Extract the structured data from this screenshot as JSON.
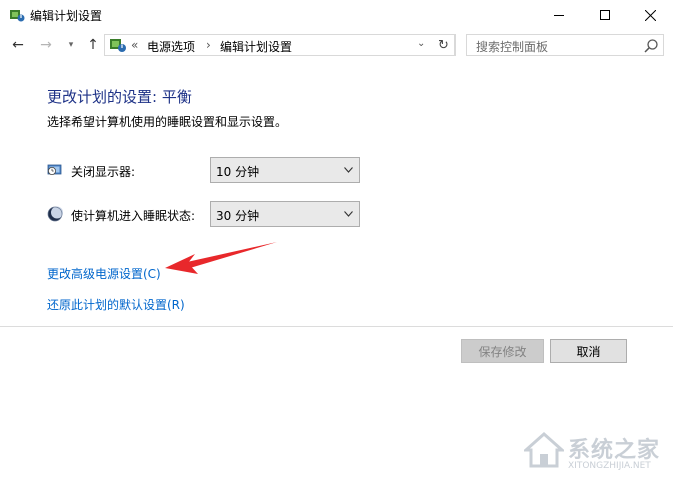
{
  "window": {
    "title": "编辑计划设置"
  },
  "nav": {
    "back_icon": "←",
    "forward_icon": "→",
    "recent_icon": "▾",
    "up_icon": "↑"
  },
  "address": {
    "more": "«",
    "part1": "电源选项",
    "separator": "›",
    "part2": "编辑计划设置",
    "dropdown": "⌄",
    "refresh": "↻"
  },
  "search": {
    "placeholder": "搜索控制面板"
  },
  "main": {
    "heading": "更改计划的设置: 平衡",
    "subtext": "选择希望计算机使用的睡眠设置和显示设置。",
    "display_off": {
      "label": "关闭显示器:",
      "value": "10 分钟"
    },
    "sleep": {
      "label": "使计算机进入睡眠状态:",
      "value": "30 分钟"
    },
    "advanced_link": "更改高级电源设置(C)",
    "restore_link": "还原此计划的默认设置(R)"
  },
  "buttons": {
    "save": "保存修改",
    "cancel": "取消"
  },
  "watermark": {
    "text": "系统之家",
    "url": "XITONGZHIJIA.NET"
  },
  "colors": {
    "heading": "#1e3287",
    "link": "#0066cc",
    "arrow": "#e8282b"
  }
}
